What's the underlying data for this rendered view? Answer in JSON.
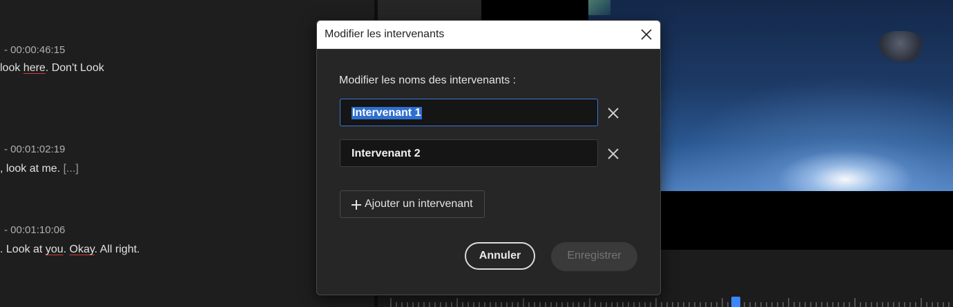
{
  "transcript": {
    "segments": [
      {
        "time": "- 00:00:46:15",
        "text_parts": [
          {
            "t": "look ",
            "u": false
          },
          {
            "t": "here",
            "u": true
          },
          {
            "t": ". Don't Look",
            "u": false
          }
        ]
      },
      {
        "time": "- 00:01:02:19",
        "text_parts": [
          {
            "t": ", look at me. ",
            "u": false
          },
          {
            "t": "[...]",
            "u": false,
            "ell": true
          }
        ]
      },
      {
        "time": "- 00:01:10:06",
        "text_parts": [
          {
            "t": ". Look at ",
            "u": false
          },
          {
            "t": "you",
            "u": true
          },
          {
            "t": ". ",
            "u": false
          },
          {
            "t": "Okay",
            "u": true
          },
          {
            "t": ". All right.",
            "u": false
          }
        ]
      }
    ]
  },
  "dialog": {
    "title": "Modifier les intervenants",
    "subtitle": "Modifier les noms des intervenants :",
    "speakers": [
      {
        "value": "Intervenant 1",
        "selected": true
      },
      {
        "value": "Intervenant 2",
        "selected": false
      }
    ],
    "add_label": "Ajouter un intervenant",
    "cancel_label": "Annuler",
    "save_label": "Enregistrer"
  },
  "icons": {
    "close": "close-icon",
    "remove": "remove-speaker-icon",
    "add": "plus-icon"
  },
  "colors": {
    "accent": "#3a78d6",
    "selection": "#2f6fd0",
    "playhead": "#3a86ff"
  }
}
